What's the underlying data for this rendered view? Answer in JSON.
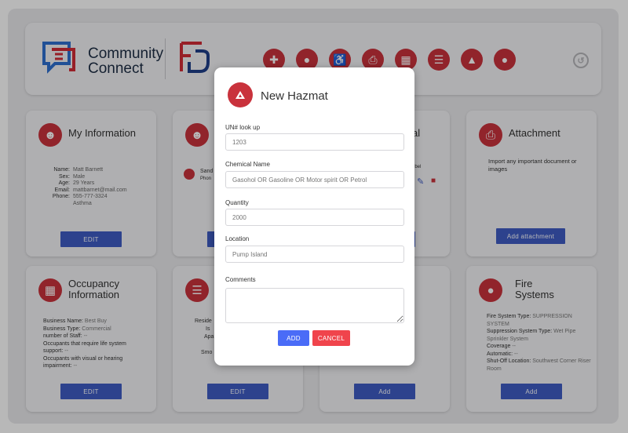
{
  "brand": {
    "name_line1": "Community",
    "name_line2": "Connect"
  },
  "nav": {
    "icons": [
      "person-plus-icon",
      "people-icon",
      "wheelchair-icon",
      "paperclip-icon",
      "building-icon",
      "floorplan-icon",
      "hazmat-icon",
      "fire-drop-icon"
    ],
    "logout_icon": "logout-icon"
  },
  "cards": {
    "my_information": {
      "title": "My Information",
      "fields": [
        {
          "label": "Name:",
          "value": "Matt Barnett"
        },
        {
          "label": "Sex:",
          "value": "Male"
        },
        {
          "label": "Age:",
          "value": "29 Years"
        },
        {
          "label": "Email:",
          "value": "mattbarnet@mail.com"
        },
        {
          "label": "Phone:",
          "value": "555-777-3324"
        },
        {
          "label": "",
          "value": "Asthma"
        }
      ],
      "button": "EDIT"
    },
    "residents": {
      "partial_name": "Sand",
      "partial_phone": "Phon",
      "button": ""
    },
    "special": {
      "partial_title": "al",
      "partial_text": "ibel"
    },
    "attachment": {
      "title": "Attachment",
      "text": "Import any important document or images",
      "button": "Add attachment"
    },
    "occupancy": {
      "title_line1": "Occupancy",
      "title_line2": "Information",
      "lines": [
        {
          "label": "Business Name:",
          "value": "Best Buy"
        },
        {
          "label": "Business Type:",
          "value": "Commercial"
        },
        {
          "label": "number of Staff:",
          "value": "--"
        },
        {
          "label": "Occupants that require life system support:",
          "value": "--"
        },
        {
          "label": "Occupants with visual or hearing impairment:",
          "value": "--"
        }
      ],
      "button": "EDIT"
    },
    "residence": {
      "lines": [
        "Reside",
        "Is",
        "Apa",
        "Smo"
      ],
      "button": "EDIT"
    },
    "hazmat": {
      "button": "Add"
    },
    "fire": {
      "title_line1": "Fire",
      "title_line2": "Systems",
      "lines": [
        {
          "label": "Fire System Type:",
          "value": "SUPPRESSION SYSTEM"
        },
        {
          "label": "Suppression System Type:",
          "value": "Wet Pipe Sprinkler System"
        },
        {
          "label": "Coverage",
          "value": "--"
        },
        {
          "label": "Automatic:",
          "value": "--"
        },
        {
          "label": "Shut-Off Location:",
          "value": "Southwest Corner Riser Room"
        }
      ],
      "button": "Add"
    }
  },
  "modal": {
    "title": "New Hazmat",
    "fields": [
      {
        "label": "UN# look up",
        "placeholder": "1203"
      },
      {
        "label": "Chemical Name",
        "placeholder": "Gasohol OR Gasoline OR Motor spirit OR Petrol"
      },
      {
        "label": "Quantity",
        "placeholder": "2000"
      },
      {
        "label": "Location",
        "placeholder": "Pump Island"
      },
      {
        "label": "Comments",
        "placeholder": ""
      }
    ],
    "add_button": "ADD",
    "cancel_button": "CANCEL"
  },
  "colors": {
    "accent_red": "#c9323c",
    "primary_blue": "#3f5cc4",
    "add_blue": "#4a6cf7",
    "cancel_red": "#f0444c"
  }
}
